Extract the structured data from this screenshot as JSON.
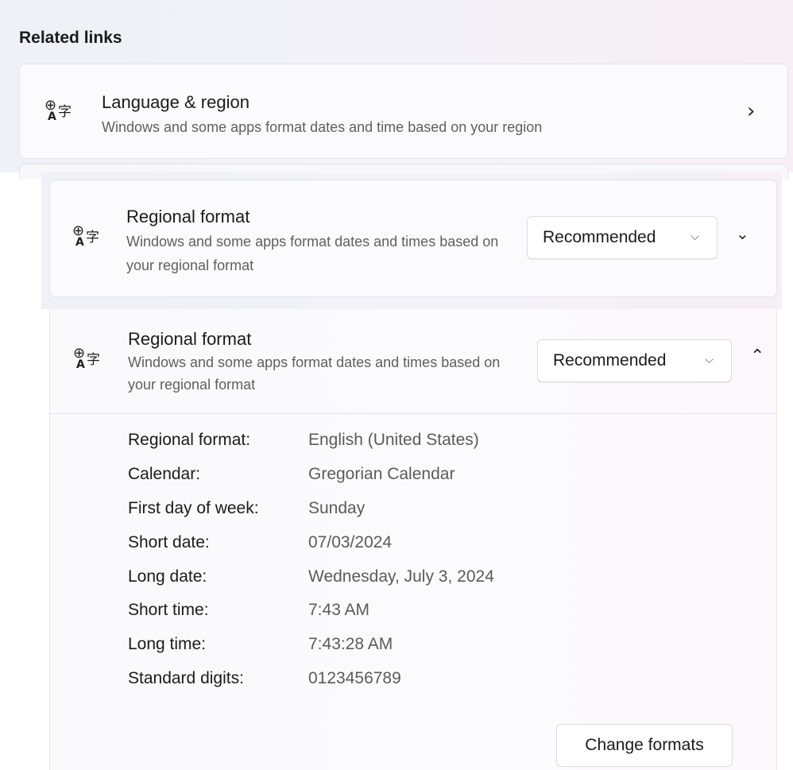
{
  "related_links": {
    "title": "Related links",
    "language_region": {
      "title": "Language & region",
      "description": "Windows and some apps format dates and time based on your region"
    }
  },
  "regional_format_collapsed": {
    "title": "Regional format",
    "description": "Windows and some apps format dates and times based on your regional format",
    "dropdown_value": "Recommended",
    "expanded": false
  },
  "regional_format_expanded": {
    "title": "Regional format",
    "description": "Windows and some apps format dates and times based on your regional format",
    "dropdown_value": "Recommended",
    "expanded": true,
    "details": [
      {
        "label": "Regional format:",
        "value": "English (United States)"
      },
      {
        "label": "Calendar:",
        "value": "Gregorian Calendar"
      },
      {
        "label": "First day of week:",
        "value": "Sunday"
      },
      {
        "label": "Short date:",
        "value": "07/03/2024"
      },
      {
        "label": "Long date:",
        "value": "Wednesday, July 3, 2024"
      },
      {
        "label": "Short time:",
        "value": "7:43 AM"
      },
      {
        "label": "Long time:",
        "value": "7:43:28 AM"
      },
      {
        "label": "Standard digits:",
        "value": "0123456789"
      }
    ],
    "change_formats_label": "Change formats"
  },
  "icons": {
    "language": "language-icon",
    "chevron_right": "chevron-right-icon",
    "chevron_down": "chevron-down-icon",
    "chevron_up": "chevron-up-icon"
  }
}
